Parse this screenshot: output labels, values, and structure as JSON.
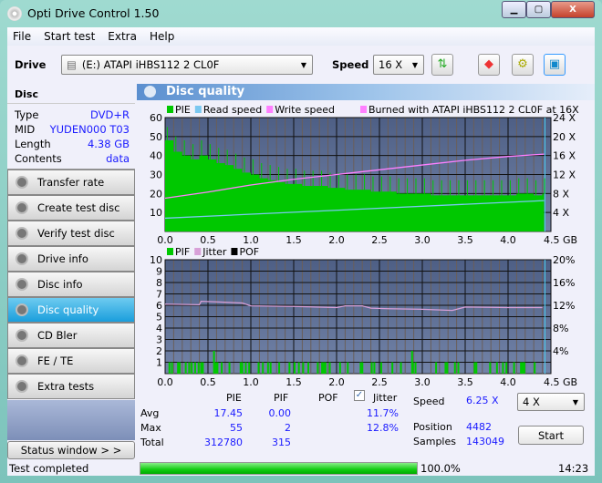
{
  "window": {
    "title": "Opti Drive Control 1.50",
    "min": "▁",
    "max": "▢",
    "close": "X"
  },
  "menu": [
    "File",
    "Start test",
    "Extra",
    "Help"
  ],
  "toolbar": {
    "drive_label": "Drive",
    "drive_value": "(E:)   ATAPI iHBS112   2 CL0F",
    "speed_label": "Speed",
    "speed_value": "16 X"
  },
  "disc": {
    "heading": "Disc",
    "fields": [
      {
        "k": "Type",
        "v": "DVD+R"
      },
      {
        "k": "MID",
        "v": "YUDEN000 T03"
      },
      {
        "k": "Length",
        "v": "4.38 GB"
      },
      {
        "k": "Contents",
        "v": "data"
      }
    ]
  },
  "nav": [
    "Transfer rate",
    "Create test disc",
    "Verify test disc",
    "Drive info",
    "Disc info",
    "Disc quality",
    "CD Bler",
    "FE / TE",
    "Extra tests"
  ],
  "nav_active": "Disc quality",
  "status_window": "Status window > >",
  "panel_title": "Disc quality",
  "chart_data": [
    {
      "type": "bar",
      "legend": [
        "PIE",
        "Read speed",
        "Write speed"
      ],
      "legend_note": "Burned with ATAPI iHBS112   2 CL0F at 16X",
      "x_ticks": [
        "0.0",
        "0.5",
        "1.0",
        "1.5",
        "2.0",
        "2.5",
        "3.0",
        "3.5",
        "4.0",
        "4.5 GB"
      ],
      "xlim": [
        0,
        4.5
      ],
      "y_ticks": [
        "10",
        "20",
        "30",
        "40",
        "50",
        "60"
      ],
      "ylim": [
        0,
        60
      ],
      "y2_ticks": [
        "4 X",
        "8 X",
        "12 X",
        "16 X",
        "20 X",
        "24 X"
      ],
      "y2lim": [
        0,
        24
      ],
      "colors": {
        "pie": "#00c800",
        "read": "#7ac8f0",
        "write": "#ff80ff"
      },
      "pie_step_gb": 0.1,
      "pie": [
        48,
        42,
        40,
        38,
        40,
        38,
        36,
        35,
        33,
        31,
        30,
        28,
        27,
        26,
        25,
        25,
        24,
        24,
        24,
        23,
        23,
        22,
        22,
        22,
        21,
        21,
        21,
        20,
        20,
        20,
        20,
        19,
        19,
        19,
        19,
        19,
        19,
        19,
        19,
        19,
        19,
        20,
        20,
        19,
        20
      ],
      "pie_max": 55,
      "read_speed": {
        "x": [
          0,
          4.42
        ],
        "y": [
          2.8,
          6.5
        ]
      },
      "write_speed": {
        "x": [
          0,
          0.5,
          1.0,
          1.5,
          2.0,
          2.5,
          3.0,
          3.5,
          4.0,
          4.42
        ],
        "y": [
          7,
          8.3,
          9.8,
          11,
          12,
          13,
          14,
          15,
          15.8,
          16.3
        ]
      }
    },
    {
      "type": "bar",
      "legend": [
        "PIF",
        "Jitter",
        "POF"
      ],
      "x_ticks": [
        "0.0",
        "0.5",
        "1.0",
        "1.5",
        "2.0",
        "2.5",
        "3.0",
        "3.5",
        "4.0",
        "4.5 GB"
      ],
      "xlim": [
        0,
        4.5
      ],
      "y_ticks": [
        "1",
        "2",
        "3",
        "4",
        "5",
        "6",
        "7",
        "8",
        "9",
        "10"
      ],
      "ylim": [
        0,
        10
      ],
      "y2_ticks": [
        "4%",
        "8%",
        "12%",
        "16%",
        "20%"
      ],
      "y2lim": [
        0,
        20
      ],
      "colors": {
        "pif": "#00c800",
        "jitter": "#d8a0d8",
        "pof": "#000000"
      },
      "pif_x": [
        0.04,
        0.07,
        0.14,
        0.15,
        0.16,
        0.23,
        0.27,
        0.3,
        0.34,
        0.38,
        0.41,
        0.42,
        0.43,
        0.56,
        0.58,
        0.6,
        0.65,
        0.74,
        0.87,
        0.89,
        0.93,
        0.97,
        1.08,
        1.13,
        1.19,
        1.22,
        1.32,
        1.44,
        1.5,
        1.55,
        1.6,
        1.66,
        1.77,
        1.82,
        1.84,
        1.86,
        1.91,
        2.03,
        2.12,
        2.27,
        2.29,
        2.4,
        2.43,
        2.51,
        2.64,
        2.74,
        2.87,
        2.88,
        2.91,
        3.15,
        3.26,
        3.28,
        3.37,
        3.41,
        3.6,
        3.62,
        3.78,
        3.86,
        3.93,
        3.97,
        4.06,
        4.14,
        4.16,
        4.18,
        4.3
      ],
      "pif_y": [
        1,
        1,
        1,
        1,
        1,
        1,
        1,
        1,
        1,
        1,
        1,
        1,
        1,
        2,
        1,
        1,
        1,
        1,
        1,
        1,
        1,
        1,
        1,
        1,
        1,
        1,
        1,
        1,
        1,
        1,
        1,
        1,
        1,
        1,
        1,
        1,
        1,
        1,
        1,
        1,
        1,
        1,
        1,
        1,
        1,
        1,
        2,
        1,
        1,
        1,
        1,
        1,
        1,
        1,
        1,
        1,
        1,
        1,
        1,
        1,
        1,
        1,
        1,
        1,
        1
      ],
      "jitter": {
        "x": [
          0,
          0.4,
          0.42,
          0.6,
          0.9,
          1.0,
          1.5,
          2.0,
          2.1,
          2.3,
          2.4,
          2.6,
          3.0,
          3.35,
          3.5,
          4.0,
          4.4
        ],
        "y": [
          12.2,
          12.1,
          12.7,
          12.6,
          12.4,
          11.9,
          11.8,
          11.6,
          11.9,
          11.9,
          11.5,
          11.4,
          11.3,
          11.1,
          11.7,
          11.6,
          11.6
        ]
      }
    }
  ],
  "stats": {
    "headers": [
      "PIE",
      "PIF",
      "POF",
      "Jitter"
    ],
    "rows": [
      {
        "label": "Avg",
        "pie": "17.45",
        "pif": "0.00",
        "jitter": "11.7%"
      },
      {
        "label": "Max",
        "pie": "55",
        "pif": "2",
        "jitter": "12.8%"
      },
      {
        "label": "Total",
        "pie": "312780",
        "pif": "315"
      }
    ],
    "speed_label": "Speed",
    "speed": "6.25 X",
    "position_label": "Position",
    "position": "4482",
    "samples_label": "Samples",
    "samples": "143049",
    "speed_select": "4 X",
    "start": "Start"
  },
  "statusbar": {
    "text": "Test completed",
    "progress": 100,
    "progress_text": "100.0%",
    "time": "14:23"
  }
}
